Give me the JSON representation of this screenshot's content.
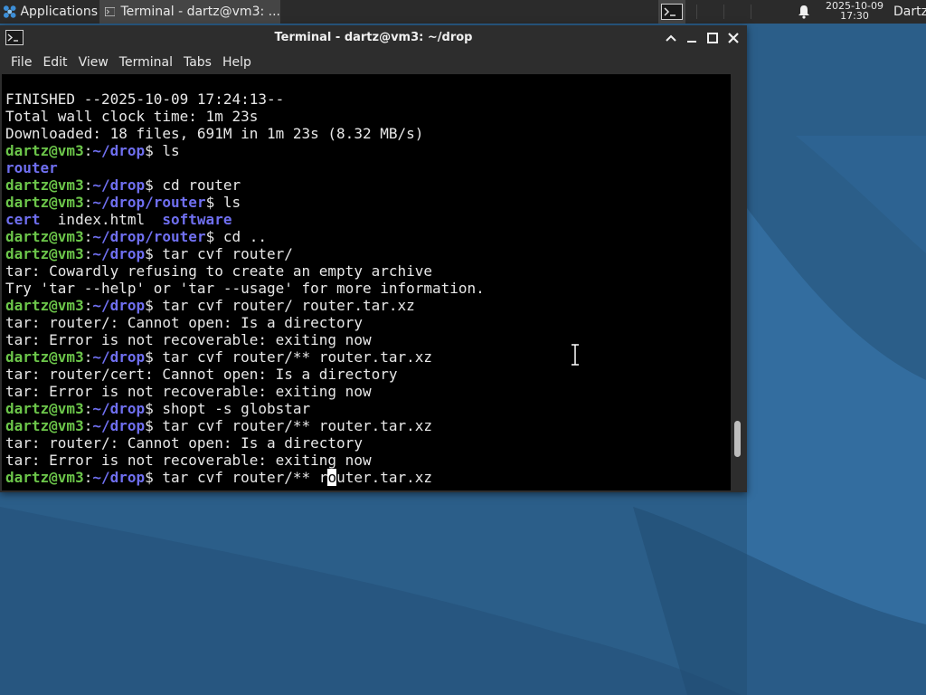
{
  "panel": {
    "applications_label": "Applications",
    "task_title": "Terminal - dartz@vm3: ...",
    "clock_date": "2025-10-09",
    "clock_time": "17:30",
    "user": "Dartz"
  },
  "window": {
    "title": "Terminal - dartz@vm3: ~/drop",
    "menu": [
      "File",
      "Edit",
      "View",
      "Terminal",
      "Tabs",
      "Help"
    ]
  },
  "terminal": {
    "scroll_fraction": 0.92,
    "lines": [
      {
        "t": "out",
        "text": "FINISHED --2025-10-09 17:24:13--"
      },
      {
        "t": "out",
        "text": "Total wall clock time: 1m 23s"
      },
      {
        "t": "out",
        "text": "Downloaded: 18 files, 691M in 1m 23s (8.32 MB/s)"
      },
      {
        "t": "prompt",
        "user": "dartz@vm3",
        "path": "~/drop",
        "cmd": " ls"
      },
      {
        "t": "dirs",
        "items": [
          "router"
        ]
      },
      {
        "t": "prompt",
        "user": "dartz@vm3",
        "path": "~/drop",
        "cmd": " cd router"
      },
      {
        "t": "prompt",
        "user": "dartz@vm3",
        "path": "~/drop/router",
        "cmd": " ls"
      },
      {
        "t": "mixed",
        "parts": [
          {
            "c": "dir",
            "s": "cert"
          },
          {
            "c": "out",
            "s": "  index.html  "
          },
          {
            "c": "dir",
            "s": "software"
          }
        ]
      },
      {
        "t": "prompt",
        "user": "dartz@vm3",
        "path": "~/drop/router",
        "cmd": " cd .."
      },
      {
        "t": "prompt",
        "user": "dartz@vm3",
        "path": "~/drop",
        "cmd": " tar cvf router/"
      },
      {
        "t": "out",
        "text": "tar: Cowardly refusing to create an empty archive"
      },
      {
        "t": "out",
        "text": "Try 'tar --help' or 'tar --usage' for more information."
      },
      {
        "t": "prompt",
        "user": "dartz@vm3",
        "path": "~/drop",
        "cmd": " tar cvf router/ router.tar.xz"
      },
      {
        "t": "out",
        "text": "tar: router/: Cannot open: Is a directory"
      },
      {
        "t": "out",
        "text": "tar: Error is not recoverable: exiting now"
      },
      {
        "t": "prompt",
        "user": "dartz@vm3",
        "path": "~/drop",
        "cmd": " tar cvf router/** router.tar.xz"
      },
      {
        "t": "out",
        "text": "tar: router/cert: Cannot open: Is a directory"
      },
      {
        "t": "out",
        "text": "tar: Error is not recoverable: exiting now"
      },
      {
        "t": "prompt",
        "user": "dartz@vm3",
        "path": "~/drop",
        "cmd": " shopt -s globstar"
      },
      {
        "t": "prompt",
        "user": "dartz@vm3",
        "path": "~/drop",
        "cmd": " tar cvf router/** router.tar.xz"
      },
      {
        "t": "out",
        "text": "tar: router/: Cannot open: Is a directory"
      },
      {
        "t": "out",
        "text": "tar: Error is not recoverable: exiting now"
      },
      {
        "t": "prompt",
        "user": "dartz@vm3",
        "path": "~/drop",
        "cmd_before": " tar cvf router/** r",
        "cursor": "o",
        "cmd_after": "uter.tar.xz"
      }
    ]
  },
  "colors": {
    "prompt_user": "#6cc64a",
    "prompt_path": "#6f6ff0",
    "terminal_bg": "#000000",
    "panel_bg": "#2b2b2b"
  }
}
